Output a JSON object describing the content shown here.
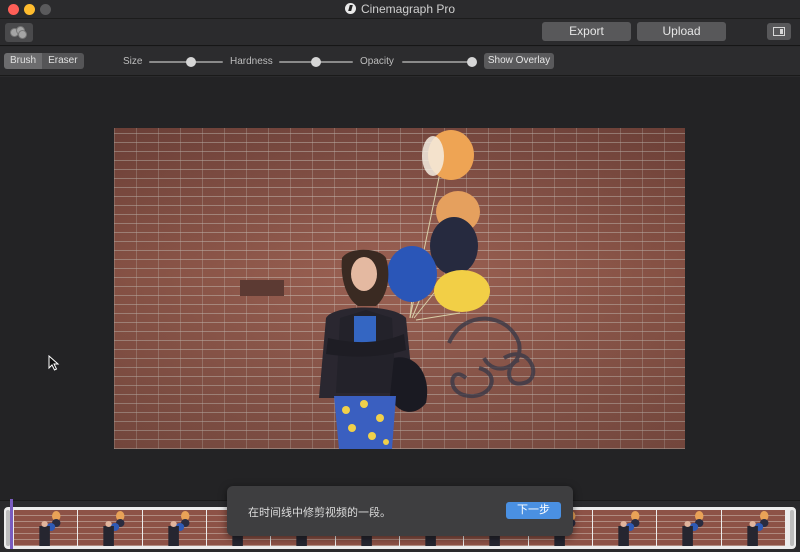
{
  "window": {
    "title": "Cinemagraph Pro"
  },
  "toolbar": {
    "export_label": "Export",
    "upload_label": "Upload"
  },
  "controls": {
    "brush_label": "Brush",
    "eraser_label": "Eraser",
    "size_label": "Size",
    "hardness_label": "Hardness",
    "opacity_label": "Opacity",
    "show_overlay_label": "Show Overlay",
    "size_value": 0.57,
    "hardness_value": 0.5,
    "opacity_value": 1.0
  },
  "colors": {
    "accent": "#4a90e2",
    "playhead": "#7a5cc0"
  },
  "timeline": {
    "frame_count": 12
  },
  "tooltip": {
    "message": "在时间线中修剪视频的一段。",
    "next_label": "下一步"
  }
}
